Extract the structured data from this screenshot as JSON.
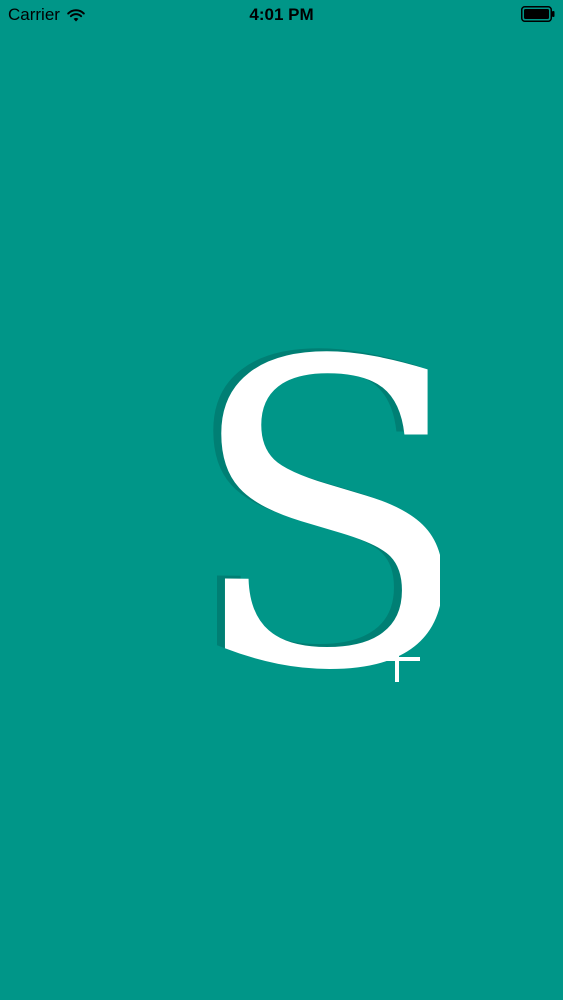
{
  "status_bar": {
    "carrier": "Carrier",
    "time": "4:01 PM",
    "icons": [
      "wifi-icon",
      "battery-icon"
    ]
  },
  "splash": {
    "logo_icon": "s-plus-logo-icon"
  },
  "colors": {
    "background": "#009688",
    "logo": "#ffffff",
    "status_text": "#000000"
  }
}
